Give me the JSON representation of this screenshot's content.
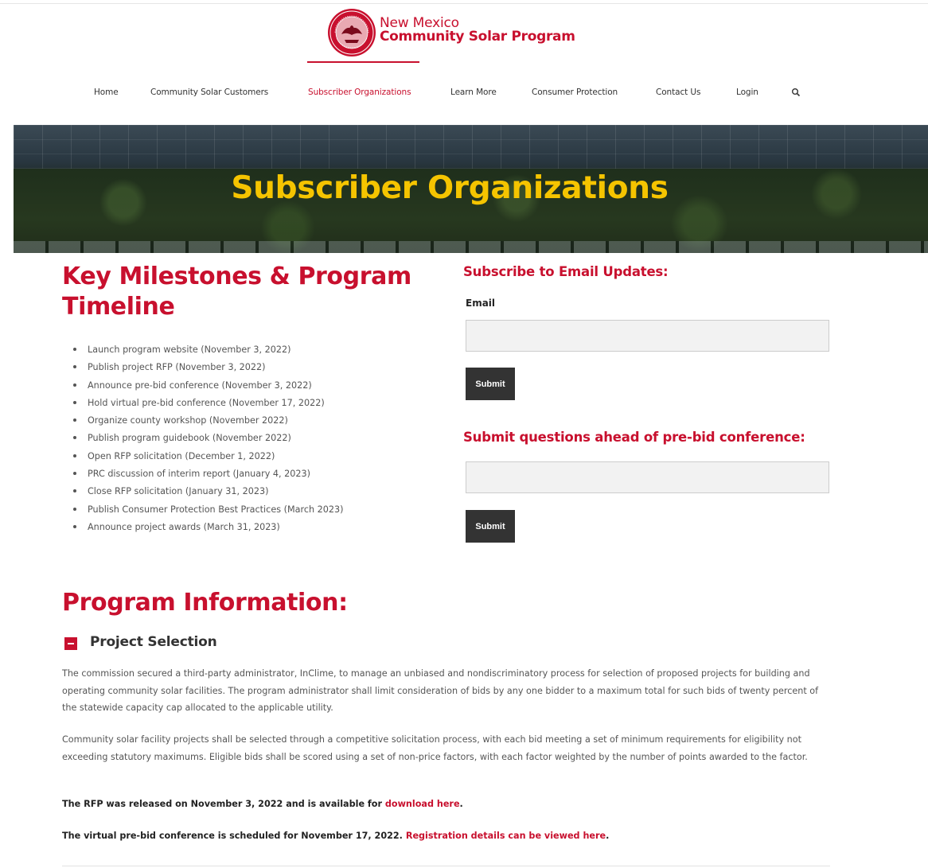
{
  "header": {
    "logo_line1": "New Mexico",
    "logo_line2": "Community Solar Program",
    "brand_color": "#c8102e"
  },
  "nav": {
    "items": [
      {
        "label": "Home"
      },
      {
        "label": "Community Solar Customers"
      },
      {
        "label": "Subscriber Organizations",
        "active": true
      },
      {
        "label": "Learn More"
      },
      {
        "label": "Consumer Protection"
      },
      {
        "label": "Contact Us"
      },
      {
        "label": "Login"
      }
    ],
    "search_icon": "search-icon"
  },
  "hero": {
    "title": "Subscriber Organizations",
    "title_color": "#f5c400"
  },
  "milestones": {
    "title": "Key Milestones & Program Timeline",
    "items": [
      "Launch program website (November 3, 2022)",
      "Publish project RFP (November 3, 2022)",
      "Announce pre-bid conference (November 3, 2022)",
      "Hold virtual pre-bid conference (November 17, 2022)",
      "Organize county workshop (November 2022)",
      "Publish program guidebook (November 2022)",
      "Open RFP solicitation (December 1, 2022)",
      "PRC discussion of interim report (January 4, 2023)",
      "Close RFP solicitation (January 31, 2023)",
      "Publish Consumer Protection Best Practices (March 2023)",
      "Announce project awards (March 31, 2023)"
    ]
  },
  "subscribe": {
    "title": "Subscribe to Email Updates:",
    "email_label": "Email",
    "email_value": "",
    "submit_label": "Submit"
  },
  "questions": {
    "title": "Submit questions ahead of pre-bid conference:",
    "input_value": "",
    "submit_label": "Submit"
  },
  "program": {
    "title": "Program Information:",
    "section_title": "Project Selection",
    "toggle_icon": "minus-icon",
    "para1": "The commission secured a third-party administrator, InClime, to manage an unbiased and nondiscriminatory process for selection of proposed projects for building and operating community solar facilities. The program administrator shall limit consideration of bids by any one bidder to a maximum total for such bids of twenty percent of the statewide capacity cap allocated to the applicable utility.",
    "para2": "Community solar facility projects shall be selected through a competitive solicitation process, with each bid meeting a set of minimum requirements for eligibility not exceeding statutory maximums. Eligible bids shall be scored using a set of non-price factors, with each factor weighted by the number of points awarded to the factor.",
    "rfp_text": "The RFP was released on November 3, 2022 and is available for ",
    "rfp_link": "download here",
    "rfp_end": ".",
    "conf_text": "The virtual pre-bid conference is scheduled for November 17, 2022. ",
    "conf_link": "Registration details can be viewed here",
    "conf_end": "."
  }
}
